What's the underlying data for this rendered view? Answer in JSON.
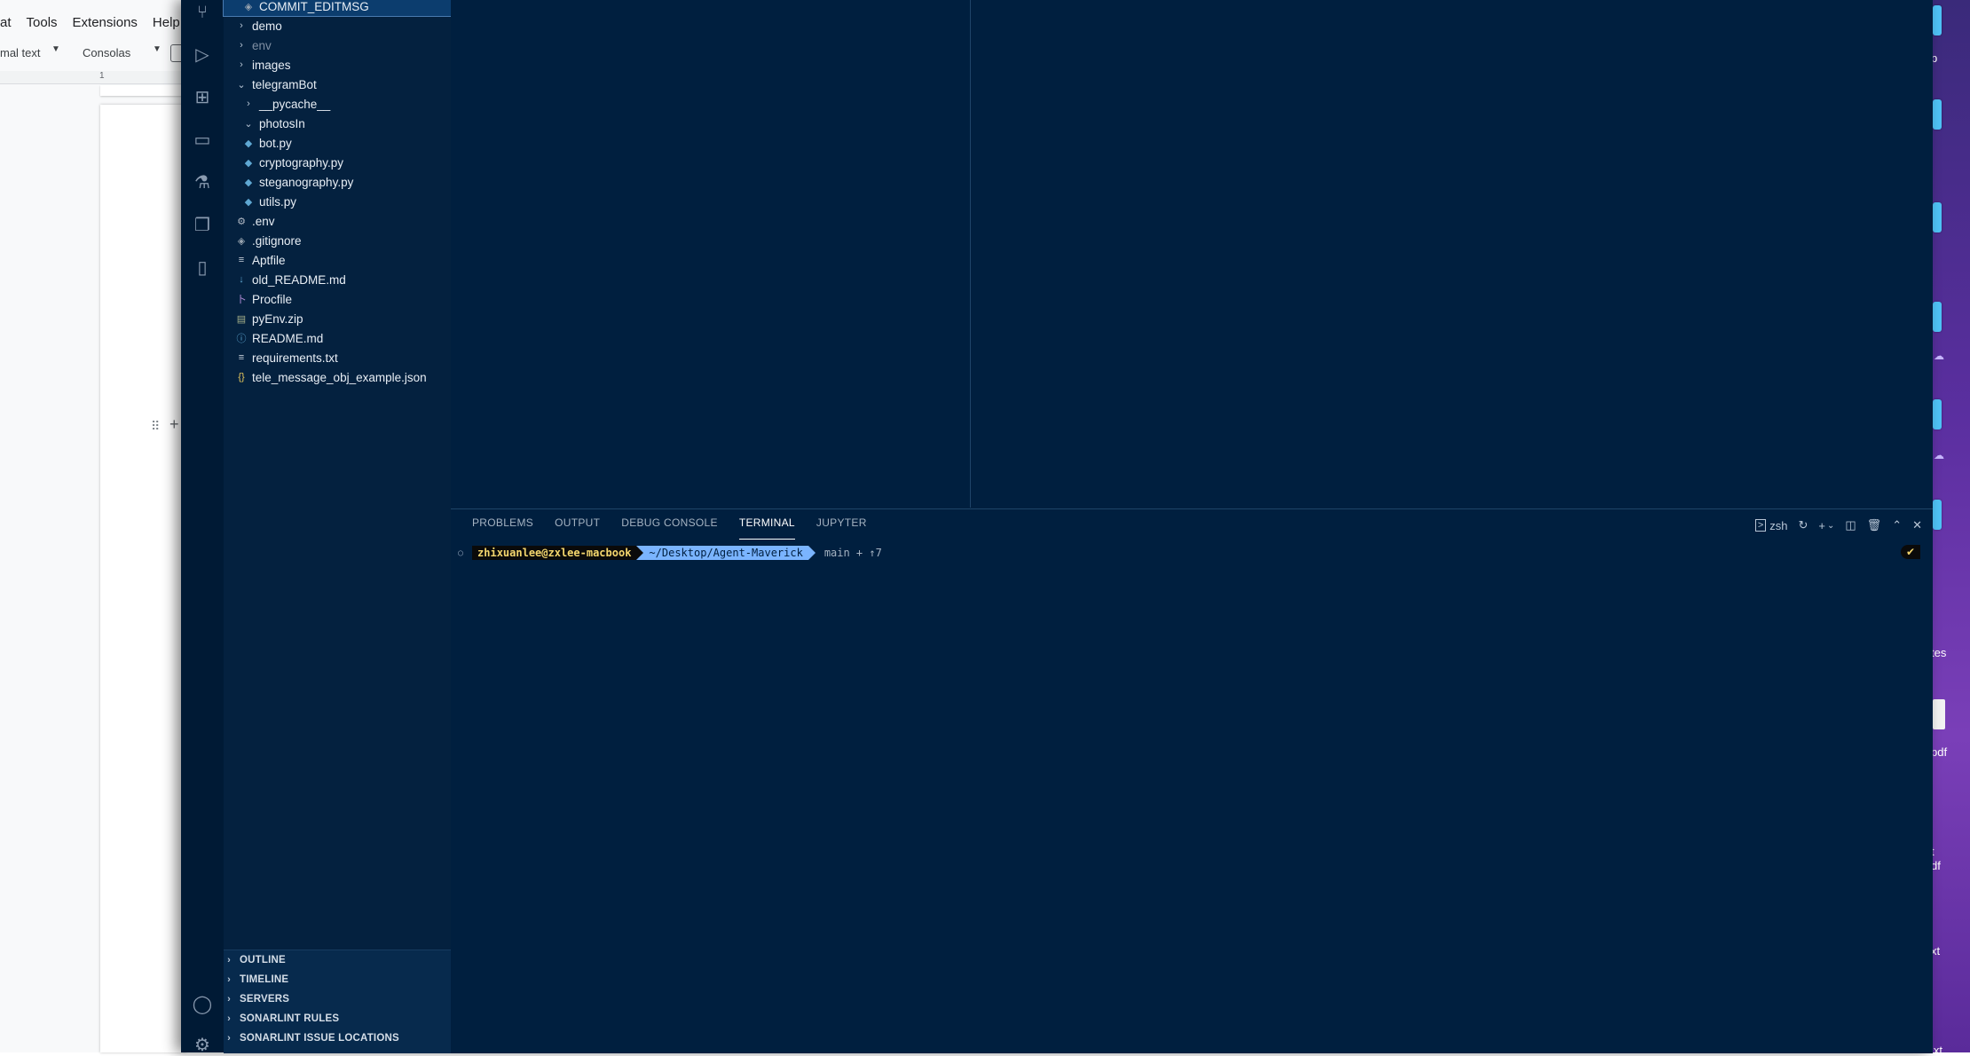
{
  "doc": {
    "menus": [
      "at",
      "Tools",
      "Extensions",
      "Help"
    ],
    "style_value": "mal text",
    "font_value": "Consolas",
    "ruler_mark": "1"
  },
  "explorer": {
    "items": [
      {
        "label": "COMMIT_EDITMSG",
        "icon": "git-icon",
        "indent": 1,
        "selected": true
      },
      {
        "label": "demo",
        "chev": "›",
        "indent": 0
      },
      {
        "label": "env",
        "chev": "›",
        "indent": 0,
        "dim": true
      },
      {
        "label": "images",
        "chev": "›",
        "indent": 0
      },
      {
        "label": "telegramBot",
        "chev": "⌄",
        "indent": 0
      },
      {
        "label": "__pycache__",
        "chev": "›",
        "indent": 1
      },
      {
        "label": "photosIn",
        "chev": "⌄",
        "indent": 1
      },
      {
        "label": "bot.py",
        "icon": "python-icon",
        "indent": 1
      },
      {
        "label": "cryptography.py",
        "icon": "python-icon",
        "indent": 1
      },
      {
        "label": "steganography.py",
        "icon": "python-icon",
        "indent": 1
      },
      {
        "label": "utils.py",
        "icon": "python-icon",
        "indent": 1
      },
      {
        "label": ".env",
        "icon": "gear-icon",
        "indent": 0
      },
      {
        "label": ".gitignore",
        "icon": "git-icon",
        "indent": 0
      },
      {
        "label": "Aptfile",
        "icon": "lines-icon",
        "indent": 0
      },
      {
        "label": "old_README.md",
        "icon": "markdown-icon",
        "indent": 0
      },
      {
        "label": "Procfile",
        "icon": "procfile-icon",
        "indent": 0
      },
      {
        "label": "pyEnv.zip",
        "icon": "zip-icon",
        "indent": 0
      },
      {
        "label": "README.md",
        "icon": "info-icon",
        "indent": 0
      },
      {
        "label": "requirements.txt",
        "icon": "lines-icon",
        "indent": 0
      },
      {
        "label": "tele_message_obj_example.json",
        "icon": "json-icon",
        "indent": 0
      }
    ]
  },
  "sections": [
    "OUTLINE",
    "TIMELINE",
    "SERVERS",
    "SONARLINT RULES",
    "SONARLINT ISSUE LOCATIONS"
  ],
  "panel": {
    "tabs": [
      "PROBLEMS",
      "OUTPUT",
      "DEBUG CONSOLE",
      "TERMINAL",
      "JUPYTER"
    ],
    "active_tab": "TERMINAL",
    "shell": "zsh"
  },
  "terminal": {
    "user": "zhixuanlee@zxlee-macbook",
    "path": "~/Desktop/Agent-Maverick",
    "git": "main + ↑7",
    "status": "✔"
  },
  "desktop": {
    "labels": [
      "p",
      "tes",
      "pdf",
      "t",
      "df",
      "xt",
      "ixt"
    ]
  },
  "icons": {
    "file_icons": {
      "python-icon": "◆",
      "gear-icon": "⚙",
      "git-icon": "◈",
      "lines-icon": "≡",
      "markdown-icon": "↓",
      "procfile-icon": "卜",
      "zip-icon": "▤",
      "info-icon": "ⓘ",
      "json-icon": "{}"
    },
    "activity": [
      "source-control-icon",
      "run-debug-icon",
      "extensions-icon",
      "remote-explorer-icon",
      "testing-icon",
      "panels-icon",
      "notebook-icon",
      "account-icon",
      "settings-icon"
    ]
  }
}
